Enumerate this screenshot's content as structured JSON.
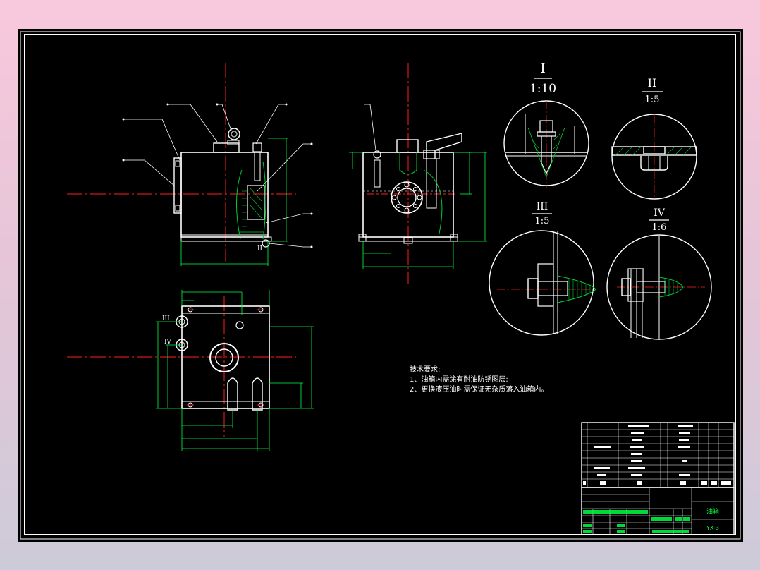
{
  "colors": {
    "background": "#000000",
    "frame": "#ffffff",
    "centerline": "#ff2020",
    "dimension": "#00ff44",
    "leader": "#ffffff",
    "text": "#ffffff",
    "hatch": "#00cc33"
  },
  "detail_views": [
    {
      "roman": "I",
      "scale": "1:10"
    },
    {
      "roman": "II",
      "scale": "1:5"
    },
    {
      "roman": "III",
      "scale": "1:5"
    },
    {
      "roman": "IV",
      "scale": "1:6"
    }
  ],
  "view_markers": {
    "front_ii": "II",
    "top_iii": "III",
    "top_iv": "IV"
  },
  "tech_requirements": {
    "heading": "技术要求:",
    "items": [
      "1、油箱内需涂有耐油防锈图层;",
      "2、更换液压油时需保证无杂质落入油箱内。"
    ]
  },
  "title_block": {
    "drawing_name": "油箱",
    "drawing_code": "YX-3"
  }
}
